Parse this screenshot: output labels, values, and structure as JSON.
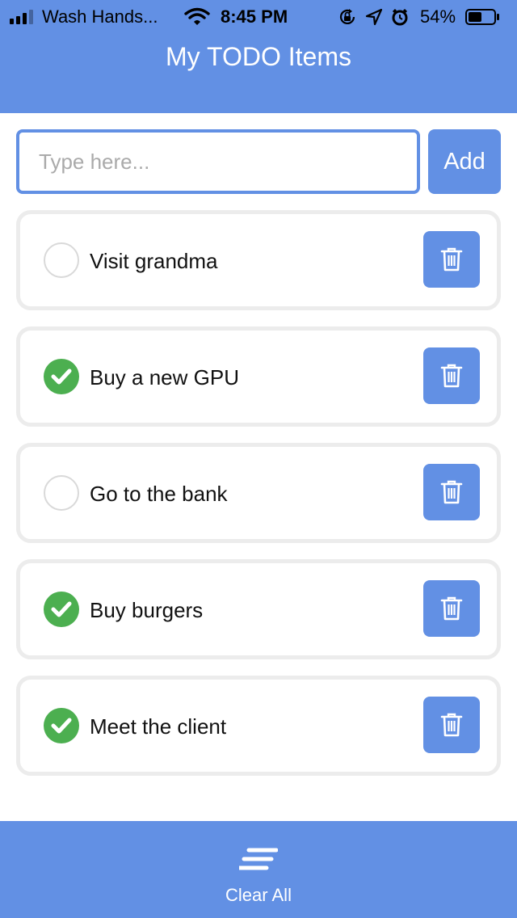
{
  "status_bar": {
    "carrier": "Wash Hands...",
    "time": "8:45 PM",
    "battery_percent": "54%",
    "battery_level": 0.54,
    "signal_bars": 3,
    "icons": [
      "signal-icon",
      "wifi-icon",
      "orientation-lock-icon",
      "location-icon",
      "alarm-icon",
      "battery-icon"
    ]
  },
  "header": {
    "title": "My TODO Items"
  },
  "new_item": {
    "placeholder": "Type here...",
    "value": "",
    "add_label": "Add"
  },
  "todos": [
    {
      "label": "Visit grandma",
      "done": false
    },
    {
      "label": "Buy a new GPU",
      "done": true
    },
    {
      "label": "Go to the bank",
      "done": false
    },
    {
      "label": "Buy burgers",
      "done": true
    },
    {
      "label": "Meet the client",
      "done": true
    }
  ],
  "footer": {
    "clear_label": "Clear All",
    "icon": "clear-all-icon"
  },
  "colors": {
    "accent": "#6290E4",
    "done": "#4CAF50",
    "item_border": "#ECECEC"
  }
}
